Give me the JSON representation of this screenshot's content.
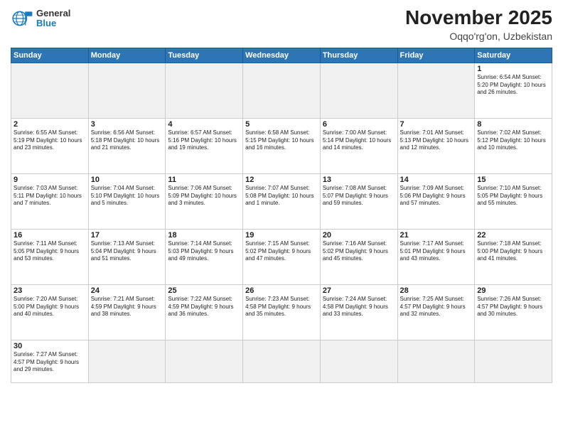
{
  "header": {
    "logo_line1": "General",
    "logo_line2": "Blue",
    "month_title": "November 2025",
    "location": "Oqqo'rg'on, Uzbekistan"
  },
  "days_of_week": [
    "Sunday",
    "Monday",
    "Tuesday",
    "Wednesday",
    "Thursday",
    "Friday",
    "Saturday"
  ],
  "weeks": [
    [
      {
        "day": "",
        "empty": true
      },
      {
        "day": "",
        "empty": true
      },
      {
        "day": "",
        "empty": true
      },
      {
        "day": "",
        "empty": true
      },
      {
        "day": "",
        "empty": true
      },
      {
        "day": "",
        "empty": true
      },
      {
        "day": "1",
        "info": "Sunrise: 6:54 AM\nSunset: 5:20 PM\nDaylight: 10 hours\nand 26 minutes."
      }
    ],
    [
      {
        "day": "2",
        "info": "Sunrise: 6:55 AM\nSunset: 5:19 PM\nDaylight: 10 hours\nand 23 minutes."
      },
      {
        "day": "3",
        "info": "Sunrise: 6:56 AM\nSunset: 5:18 PM\nDaylight: 10 hours\nand 21 minutes."
      },
      {
        "day": "4",
        "info": "Sunrise: 6:57 AM\nSunset: 5:16 PM\nDaylight: 10 hours\nand 19 minutes."
      },
      {
        "day": "5",
        "info": "Sunrise: 6:58 AM\nSunset: 5:15 PM\nDaylight: 10 hours\nand 16 minutes."
      },
      {
        "day": "6",
        "info": "Sunrise: 7:00 AM\nSunset: 5:14 PM\nDaylight: 10 hours\nand 14 minutes."
      },
      {
        "day": "7",
        "info": "Sunrise: 7:01 AM\nSunset: 5:13 PM\nDaylight: 10 hours\nand 12 minutes."
      },
      {
        "day": "8",
        "info": "Sunrise: 7:02 AM\nSunset: 5:12 PM\nDaylight: 10 hours\nand 10 minutes."
      }
    ],
    [
      {
        "day": "9",
        "info": "Sunrise: 7:03 AM\nSunset: 5:11 PM\nDaylight: 10 hours\nand 7 minutes."
      },
      {
        "day": "10",
        "info": "Sunrise: 7:04 AM\nSunset: 5:10 PM\nDaylight: 10 hours\nand 5 minutes."
      },
      {
        "day": "11",
        "info": "Sunrise: 7:06 AM\nSunset: 5:09 PM\nDaylight: 10 hours\nand 3 minutes."
      },
      {
        "day": "12",
        "info": "Sunrise: 7:07 AM\nSunset: 5:08 PM\nDaylight: 10 hours\nand 1 minute."
      },
      {
        "day": "13",
        "info": "Sunrise: 7:08 AM\nSunset: 5:07 PM\nDaylight: 9 hours\nand 59 minutes."
      },
      {
        "day": "14",
        "info": "Sunrise: 7:09 AM\nSunset: 5:06 PM\nDaylight: 9 hours\nand 57 minutes."
      },
      {
        "day": "15",
        "info": "Sunrise: 7:10 AM\nSunset: 5:05 PM\nDaylight: 9 hours\nand 55 minutes."
      }
    ],
    [
      {
        "day": "16",
        "info": "Sunrise: 7:11 AM\nSunset: 5:05 PM\nDaylight: 9 hours\nand 53 minutes."
      },
      {
        "day": "17",
        "info": "Sunrise: 7:13 AM\nSunset: 5:04 PM\nDaylight: 9 hours\nand 51 minutes."
      },
      {
        "day": "18",
        "info": "Sunrise: 7:14 AM\nSunset: 5:03 PM\nDaylight: 9 hours\nand 49 minutes."
      },
      {
        "day": "19",
        "info": "Sunrise: 7:15 AM\nSunset: 5:02 PM\nDaylight: 9 hours\nand 47 minutes."
      },
      {
        "day": "20",
        "info": "Sunrise: 7:16 AM\nSunset: 5:02 PM\nDaylight: 9 hours\nand 45 minutes."
      },
      {
        "day": "21",
        "info": "Sunrise: 7:17 AM\nSunset: 5:01 PM\nDaylight: 9 hours\nand 43 minutes."
      },
      {
        "day": "22",
        "info": "Sunrise: 7:18 AM\nSunset: 5:00 PM\nDaylight: 9 hours\nand 41 minutes."
      }
    ],
    [
      {
        "day": "23",
        "info": "Sunrise: 7:20 AM\nSunset: 5:00 PM\nDaylight: 9 hours\nand 40 minutes."
      },
      {
        "day": "24",
        "info": "Sunrise: 7:21 AM\nSunset: 4:59 PM\nDaylight: 9 hours\nand 38 minutes."
      },
      {
        "day": "25",
        "info": "Sunrise: 7:22 AM\nSunset: 4:59 PM\nDaylight: 9 hours\nand 36 minutes."
      },
      {
        "day": "26",
        "info": "Sunrise: 7:23 AM\nSunset: 4:58 PM\nDaylight: 9 hours\nand 35 minutes."
      },
      {
        "day": "27",
        "info": "Sunrise: 7:24 AM\nSunset: 4:58 PM\nDaylight: 9 hours\nand 33 minutes."
      },
      {
        "day": "28",
        "info": "Sunrise: 7:25 AM\nSunset: 4:57 PM\nDaylight: 9 hours\nand 32 minutes."
      },
      {
        "day": "29",
        "info": "Sunrise: 7:26 AM\nSunset: 4:57 PM\nDaylight: 9 hours\nand 30 minutes."
      }
    ],
    [
      {
        "day": "30",
        "info": "Sunrise: 7:27 AM\nSunset: 4:57 PM\nDaylight: 9 hours\nand 29 minutes."
      },
      {
        "day": "",
        "empty": true
      },
      {
        "day": "",
        "empty": true
      },
      {
        "day": "",
        "empty": true
      },
      {
        "day": "",
        "empty": true
      },
      {
        "day": "",
        "empty": true
      },
      {
        "day": "",
        "empty": true
      }
    ]
  ]
}
